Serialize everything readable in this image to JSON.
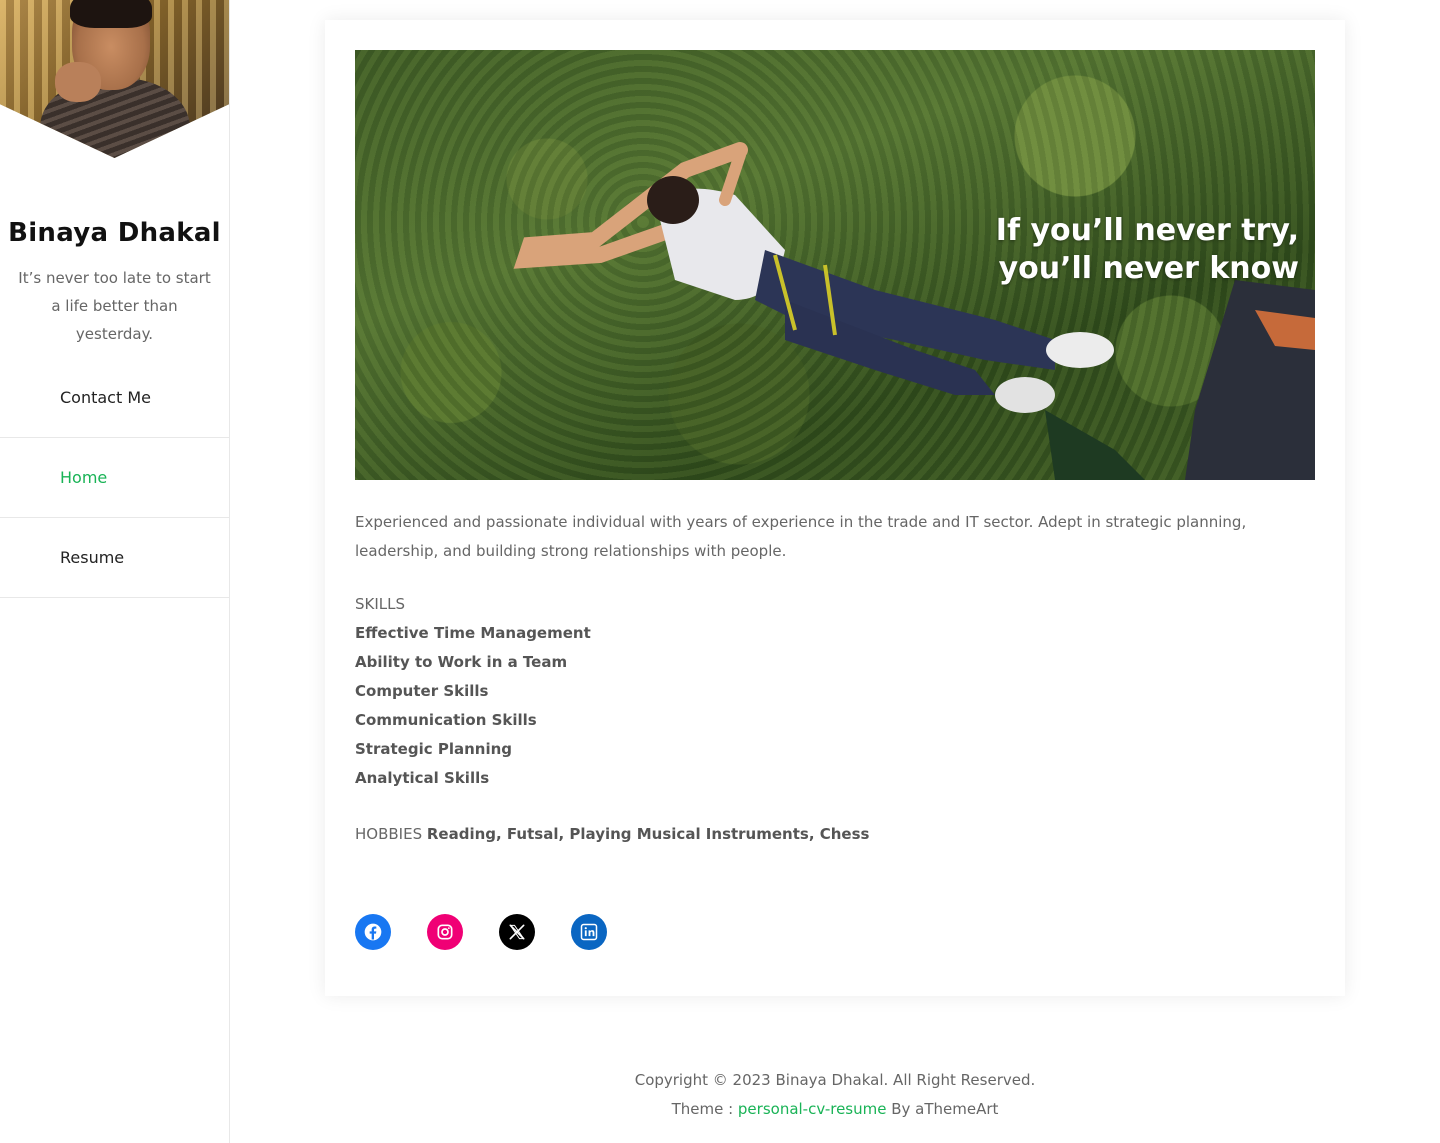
{
  "sidebar": {
    "site_title": "Binaya Dhakal",
    "tagline": "It’s never too late to start a life better than yesterday.",
    "nav": [
      {
        "label": "Contact Me",
        "active": false
      },
      {
        "label": "Home",
        "active": true
      },
      {
        "label": "Resume",
        "active": false
      }
    ]
  },
  "hero": {
    "quote_line1": "If you’ll never try,",
    "quote_line2": "you’ll never know"
  },
  "content": {
    "intro": "Experienced and passionate individual with years of experience in the trade and IT sector. Adept in strategic planning, leadership, and building strong relationships with people.",
    "skills_label": "SKILLS",
    "skills": [
      "Effective Time Management",
      "Ability to Work in a Team",
      "Computer Skills",
      "Communication Skills",
      "Strategic Planning",
      "Analytical Skills"
    ],
    "hobbies_label": "HOBBIES",
    "hobbies_value": "Reading, Futsal, Playing Musical Instruments, Chess"
  },
  "social": [
    {
      "name": "Facebook",
      "icon": "facebook-icon",
      "color": "#1877f2"
    },
    {
      "name": "Instagram",
      "icon": "instagram-icon",
      "color": "#f00075"
    },
    {
      "name": "X",
      "icon": "x-icon",
      "color": "#000000"
    },
    {
      "name": "LinkedIn",
      "icon": "linkedin-icon",
      "color": "#0a66c2"
    }
  ],
  "footer": {
    "copyright": "Copyright © 2023 Binaya Dhakal. All Right Reserved.",
    "theme_prefix": "Theme : ",
    "theme_link": "personal-cv-resume",
    "theme_suffix": " By aThemeArt"
  },
  "colors": {
    "accent": "#19b356",
    "text": "#666666",
    "heading": "#111111"
  }
}
